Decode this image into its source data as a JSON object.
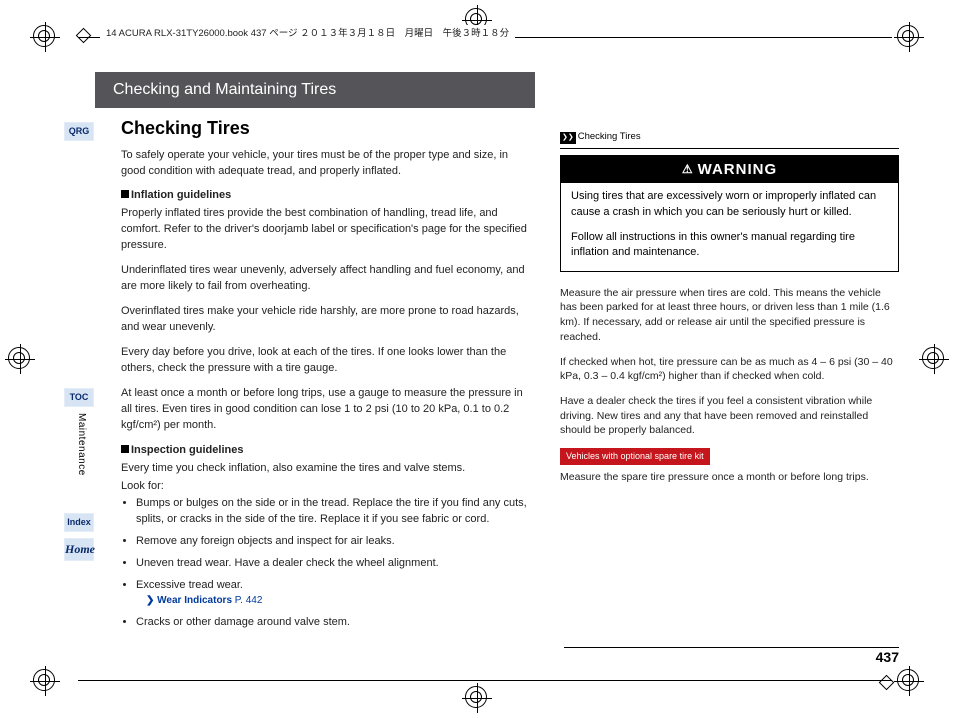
{
  "header_meta": "14 ACURA RLX-31TY26000.book  437 ページ  ２０１３年３月１８日　月曜日　午後３時１８分",
  "page_number": "437",
  "title_bar": "Checking and Maintaining Tires",
  "section_title": "Checking Tires",
  "intro": "To safely operate your vehicle, your tires must be of the proper type and size, in good condition with adequate tread, and properly inflated.",
  "sub1_head": "Inflation guidelines",
  "sub1_p1": "Properly inflated tires provide the best combination of handling, tread life, and comfort. Refer to the driver's doorjamb label or specification's page for the specified pressure.",
  "sub1_p2": "Underinflated tires wear unevenly, adversely affect handling and fuel economy, and are more likely to fail from overheating.",
  "sub1_p3": "Overinflated tires make your vehicle ride harshly, are more prone to road hazards, and wear unevenly.",
  "sub1_p4": "Every day before you drive, look at each of the tires. If one looks lower than the others, check the pressure with a tire gauge.",
  "sub1_p5": "At least once a month or before long trips, use a gauge to measure the pressure in all tires. Even tires in good condition can lose 1 to 2 psi (10 to 20 kPa, 0.1 to 0.2 kgf/cm²) per month.",
  "sub2_head": "Inspection guidelines",
  "sub2_p1": "Every time you check inflation, also examine the tires and valve stems.",
  "sub2_p2": "Look for:",
  "bullets": [
    "Bumps or bulges on the side or in the tread. Replace the tire if you find any cuts, splits, or cracks in the side of the tire. Replace it if you see fabric or cord.",
    "Remove any foreign objects and inspect for air leaks.",
    "Uneven tread wear. Have a dealer check the wheel alignment.",
    "Excessive tread wear.",
    "Cracks or other damage around valve stem."
  ],
  "wear_link": "Wear Indicators",
  "wear_page": "P. 442",
  "nav": {
    "qrg": "QRG",
    "toc": "TOC",
    "index": "Index",
    "home": "Home",
    "tab": "Maintenance"
  },
  "crumb": "Checking Tires",
  "warning_title": "WARNING",
  "warning_p1": "Using tires that are excessively worn or improperly inflated can cause a crash in which you can be seriously hurt or killed.",
  "warning_p2": "Follow all instructions in this owner's manual regarding tire inflation and maintenance.",
  "note_p1": "Measure the air pressure when tires are cold. This means the vehicle has been parked for at least three hours, or driven less than 1 mile (1.6 km). If necessary, add or release air until the specified pressure is reached.",
  "note_p2": "If checked when hot, tire pressure can be as much as 4 – 6 psi (30 – 40 kPa, 0.3 – 0.4 kgf/cm²) higher than if checked when cold.",
  "note_p3": "Have a dealer check the tires if you feel a consistent vibration while driving. New tires and any that have been removed and reinstalled should be properly balanced.",
  "red_tag": "Vehicles with optional spare tire kit",
  "note_p4": "Measure the spare tire pressure once a month or before long trips."
}
